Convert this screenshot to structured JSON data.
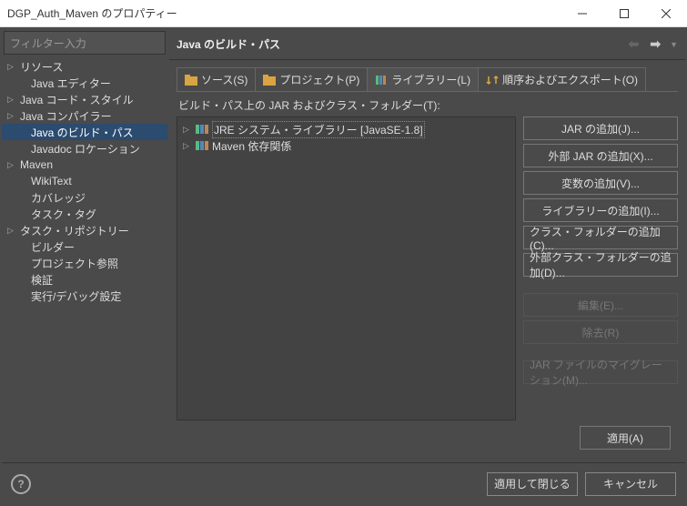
{
  "window": {
    "title": "DGP_Auth_Maven のプロパティー"
  },
  "filter": {
    "placeholder": "フィルター入力"
  },
  "sidebar": {
    "items": [
      {
        "label": "リソース",
        "expandable": true
      },
      {
        "label": "Java エディター",
        "expandable": false
      },
      {
        "label": "Java コード・スタイル",
        "expandable": true
      },
      {
        "label": "Java コンパイラー",
        "expandable": true
      },
      {
        "label": "Java のビルド・パス",
        "expandable": false,
        "selected": true
      },
      {
        "label": "Javadoc ロケーション",
        "expandable": false
      },
      {
        "label": "Maven",
        "expandable": true
      },
      {
        "label": "WikiText",
        "expandable": false
      },
      {
        "label": "カバレッジ",
        "expandable": false
      },
      {
        "label": "タスク・タグ",
        "expandable": false
      },
      {
        "label": "タスク・リポジトリー",
        "expandable": true
      },
      {
        "label": "ビルダー",
        "expandable": false
      },
      {
        "label": "プロジェクト参照",
        "expandable": false
      },
      {
        "label": "検証",
        "expandable": false
      },
      {
        "label": "実行/デバッグ設定",
        "expandable": false
      }
    ]
  },
  "header": {
    "title": "Java のビルド・パス"
  },
  "tabs": [
    {
      "label": "ソース(S)"
    },
    {
      "label": "プロジェクト(P)"
    },
    {
      "label": "ライブラリー(L)",
      "active": true
    },
    {
      "label": "順序およびエクスポート(O)"
    }
  ],
  "lib": {
    "desc": "ビルド・パス上の JAR およびクラス・フォルダー(T):",
    "items": [
      {
        "label": "JRE システム・ライブラリー [JavaSE-1.8]",
        "selected": true
      },
      {
        "label": "Maven 依存関係"
      }
    ]
  },
  "buttons": {
    "addJar": "JAR の追加(J)...",
    "addExtJar": "外部 JAR の追加(X)...",
    "addVar": "変数の追加(V)...",
    "addLib": "ライブラリーの追加(I)...",
    "addClassFolder": "クラス・フォルダーの追加(C)...",
    "addExtClassFolder": "外部クラス・フォルダーの追加(D)...",
    "edit": "編集(E)...",
    "remove": "除去(R)",
    "migrate": "JAR ファイルのマイグレーション(M)...",
    "apply": "適用(A)",
    "applyClose": "適用して閉じる",
    "cancel": "キャンセル"
  }
}
